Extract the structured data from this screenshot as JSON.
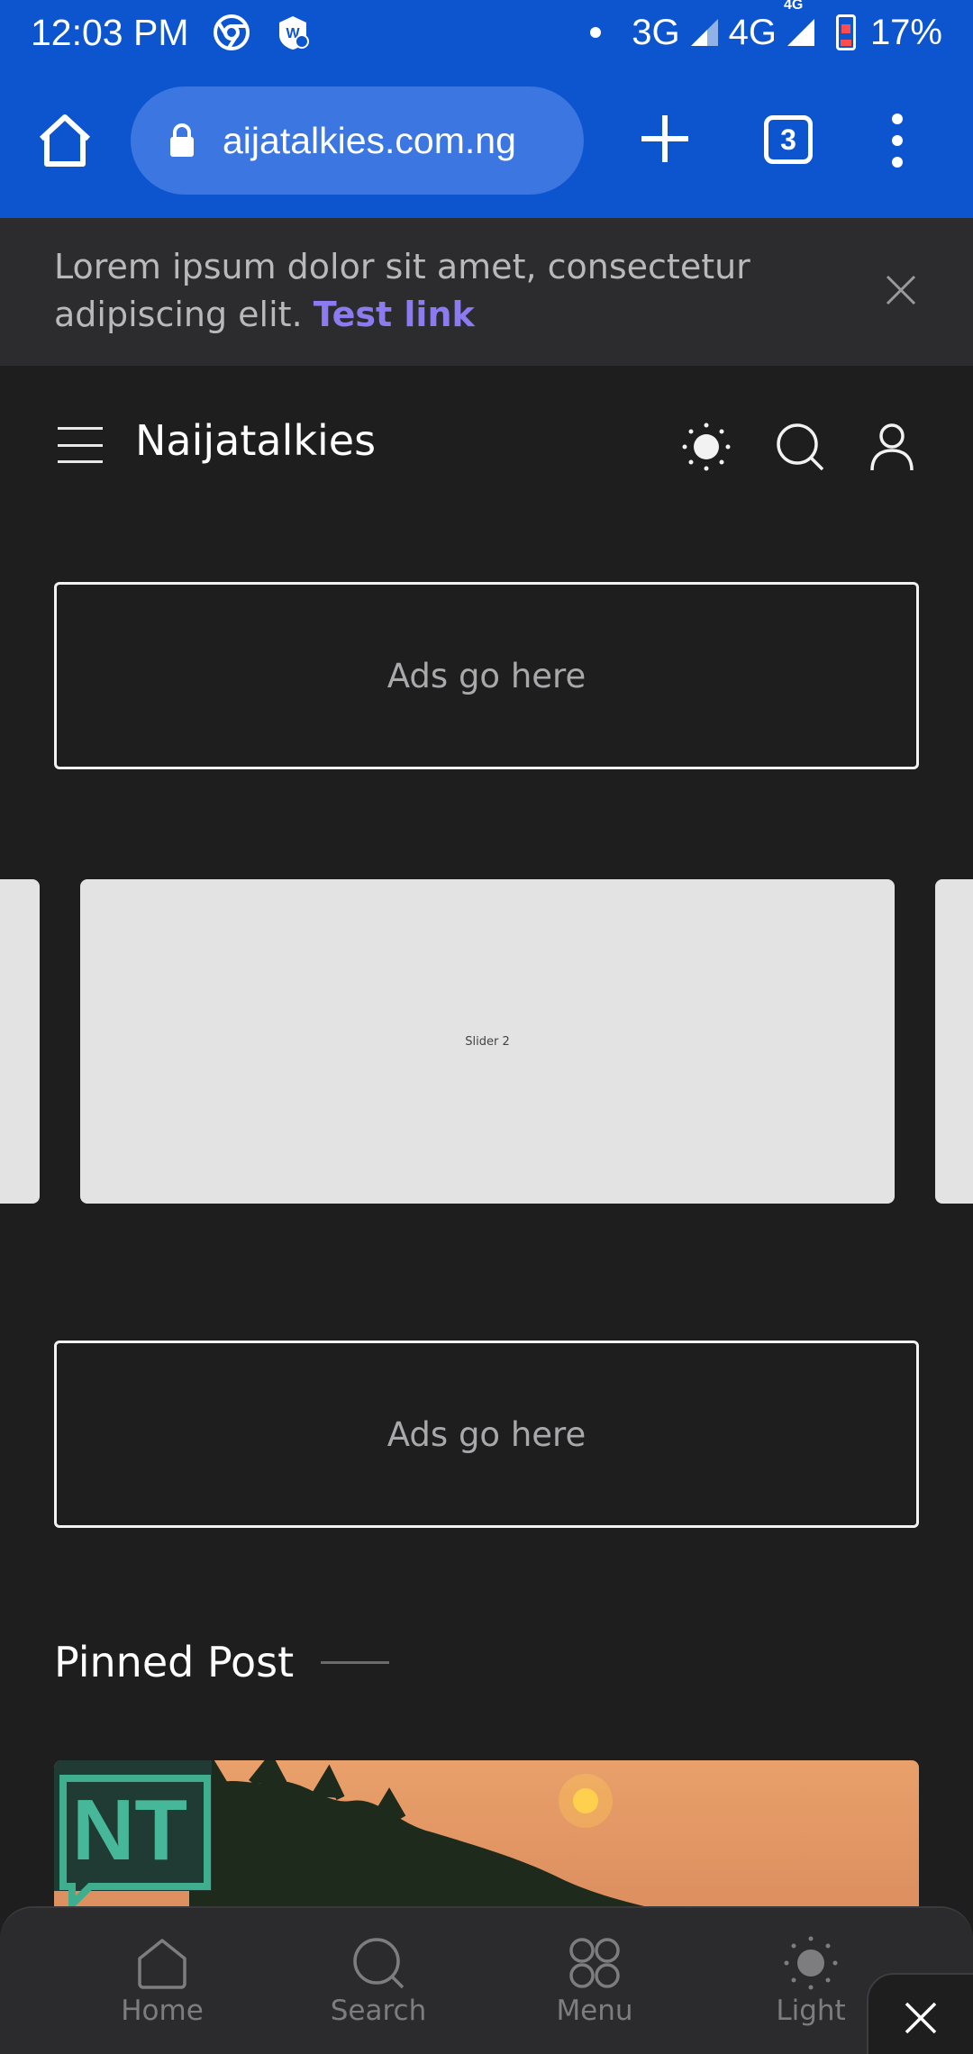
{
  "status_bar": {
    "time": "12:03 PM",
    "network_1": "3G",
    "network_2": "4G",
    "network_2_sup": "4G",
    "battery": "17%",
    "icons": [
      "chrome-icon",
      "notification-app-icon",
      "signal-icon",
      "battery-icon"
    ]
  },
  "browser": {
    "url": "aijatalkies.com.ng",
    "tab_count": "3"
  },
  "announcement": {
    "text": "Lorem ipsum dolor sit amet, consectetur adipiscing elit.",
    "link_text": "Test link"
  },
  "site": {
    "title": "Naijatalkies"
  },
  "ads": {
    "top": "Ads go here",
    "bottom": "Ads go here"
  },
  "slider": {
    "current_label": "Slider 2"
  },
  "pinned": {
    "title": "Pinned Post"
  },
  "bottom_nav": {
    "items": [
      {
        "label": "Home",
        "icon": "home-icon"
      },
      {
        "label": "Search",
        "icon": "search-icon"
      },
      {
        "label": "Menu",
        "icon": "menu-grid-icon"
      },
      {
        "label": "Light",
        "icon": "sun-icon"
      }
    ]
  },
  "colors": {
    "browser_chrome": "#0c55cf",
    "background": "#1e1e1f",
    "link": "#8c7bf0"
  }
}
